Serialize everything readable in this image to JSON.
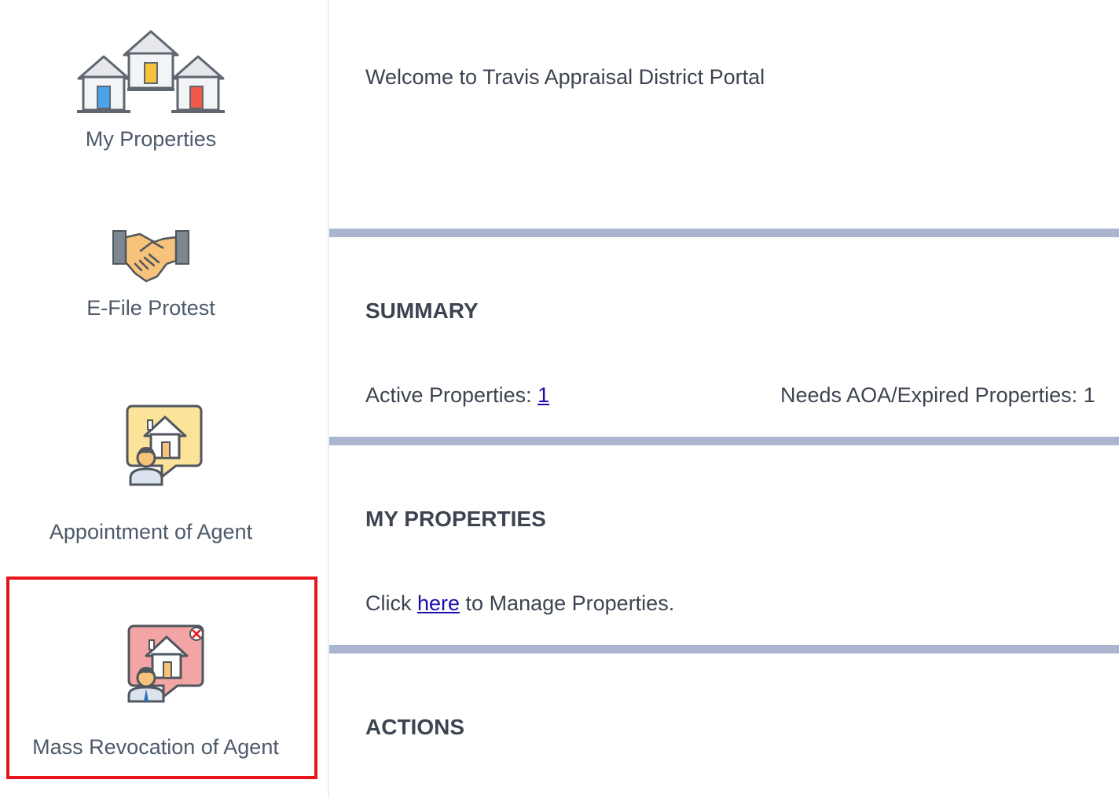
{
  "sidebar": {
    "items": [
      {
        "label": "My Properties",
        "icon": "houses-icon"
      },
      {
        "label": "E-File Protest",
        "icon": "handshake-icon"
      },
      {
        "label": "Appointment of Agent",
        "icon": "agent-house-icon"
      },
      {
        "label": "Mass Revocation of Agent",
        "icon": "agent-house-revoke-icon",
        "highlighted": true,
        "highlight_color": "#e8141b"
      }
    ]
  },
  "main": {
    "welcome": "Welcome to Travis Appraisal District Portal",
    "summary": {
      "heading": "SUMMARY",
      "active_label": "Active Properties: ",
      "active_value": "1",
      "needs_aoa_label": "Needs AOA/Expired Properties: ",
      "needs_aoa_value": "1"
    },
    "my_properties": {
      "heading": "MY PROPERTIES",
      "prefix": "Click ",
      "link": "here",
      "suffix": " to Manage Properties."
    },
    "actions": {
      "heading": "ACTIONS"
    }
  },
  "colors": {
    "divider": "#aab5d0",
    "link": "#1a0dab",
    "label_text": "#4d5a6a",
    "highlight": "#e8141b"
  }
}
